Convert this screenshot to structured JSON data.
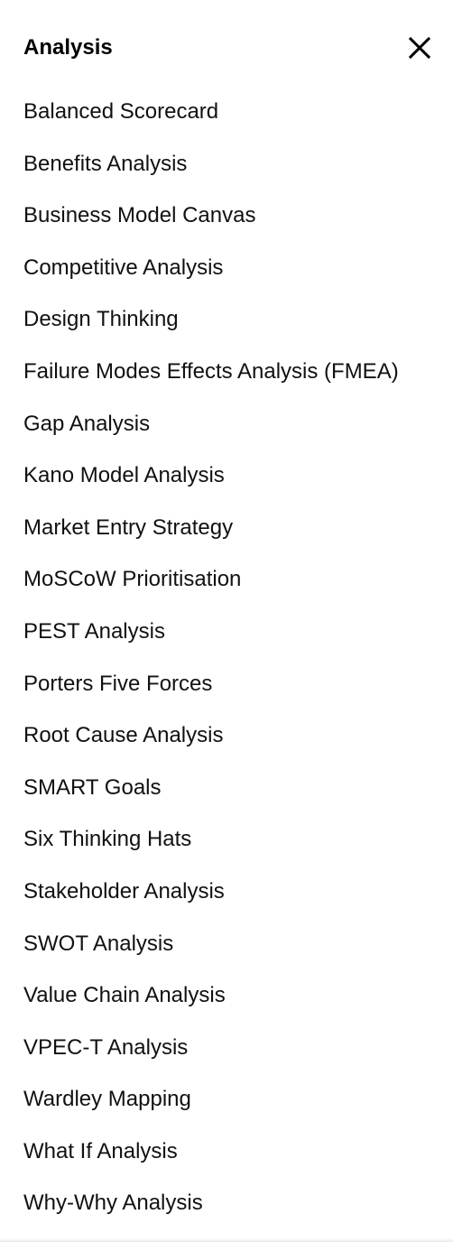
{
  "header": {
    "title": "Analysis",
    "close_icon": "close-icon"
  },
  "menu": {
    "items": [
      {
        "label": "Balanced Scorecard"
      },
      {
        "label": "Benefits Analysis"
      },
      {
        "label": "Business Model Canvas"
      },
      {
        "label": "Competitive Analysis"
      },
      {
        "label": "Design Thinking"
      },
      {
        "label": "Failure Modes Effects Analysis (FMEA)"
      },
      {
        "label": "Gap Analysis"
      },
      {
        "label": "Kano Model Analysis"
      },
      {
        "label": "Market Entry Strategy"
      },
      {
        "label": "MoSCoW Prioritisation"
      },
      {
        "label": "PEST Analysis"
      },
      {
        "label": "Porters Five Forces"
      },
      {
        "label": "Root Cause Analysis"
      },
      {
        "label": "SMART Goals"
      },
      {
        "label": "Six Thinking Hats"
      },
      {
        "label": "Stakeholder Analysis"
      },
      {
        "label": "SWOT Analysis"
      },
      {
        "label": "Value Chain Analysis"
      },
      {
        "label": "VPEC-T Analysis"
      },
      {
        "label": "Wardley Mapping"
      },
      {
        "label": "What If Analysis"
      },
      {
        "label": "Why-Why Analysis"
      }
    ]
  },
  "colors": {
    "background": "#ffffff",
    "text": "#111111",
    "title": "#000000"
  }
}
